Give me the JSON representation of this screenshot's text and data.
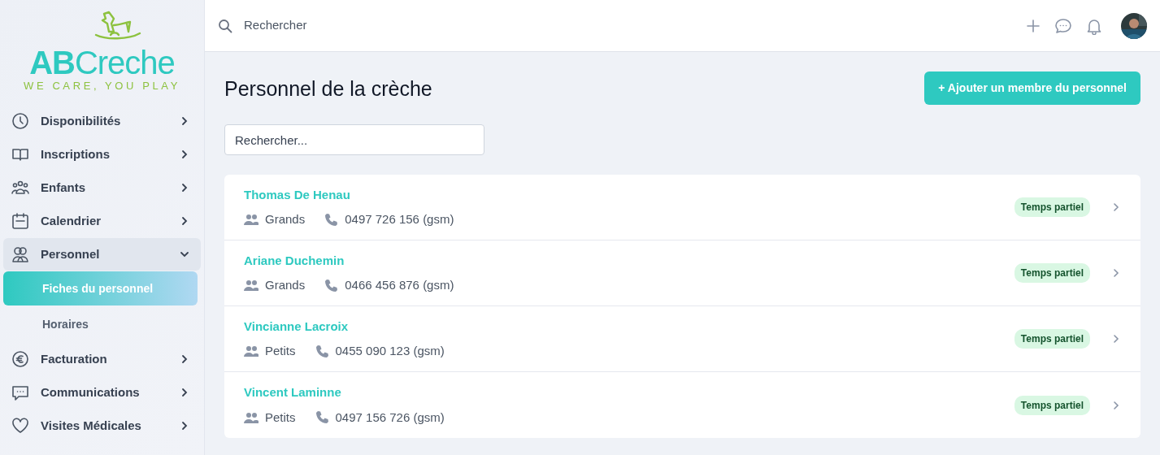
{
  "logo": {
    "name": "ABCreche",
    "tagline": "WE CARE, YOU PLAY"
  },
  "sidebar": {
    "items": [
      {
        "label": "Disponibilités",
        "expanded": false
      },
      {
        "label": "Inscriptions",
        "expanded": false
      },
      {
        "label": "Enfants",
        "expanded": false
      },
      {
        "label": "Calendrier",
        "expanded": false
      },
      {
        "label": "Personnel",
        "expanded": true,
        "children": [
          {
            "label": "Fiches du personnel",
            "selected": true
          },
          {
            "label": "Horaires",
            "selected": false
          }
        ]
      },
      {
        "label": "Facturation",
        "expanded": false
      },
      {
        "label": "Communications",
        "expanded": false
      },
      {
        "label": "Visites Médicales",
        "expanded": false
      }
    ]
  },
  "topbar": {
    "search": {
      "placeholder": "Rechercher"
    }
  },
  "page": {
    "title": "Personnel de la crèche",
    "add_button": "+ Ajouter un membre du personnel",
    "search": {
      "placeholder": "Rechercher..."
    }
  },
  "staff": [
    {
      "name": "Thomas De Henau",
      "group": "Grands",
      "phone": "0497 726 156 (gsm)",
      "status": "Temps partiel"
    },
    {
      "name": "Ariane Duchemin",
      "group": "Grands",
      "phone": "0466 456 876 (gsm)",
      "status": "Temps partiel"
    },
    {
      "name": "Vincianne Lacroix",
      "group": "Petits",
      "phone": "0455 090 123 (gsm)",
      "status": "Temps partiel"
    },
    {
      "name": "Vincent Laminne",
      "group": "Petits",
      "phone": "0497 156 726 (gsm)",
      "status": "Temps partiel"
    }
  ]
}
